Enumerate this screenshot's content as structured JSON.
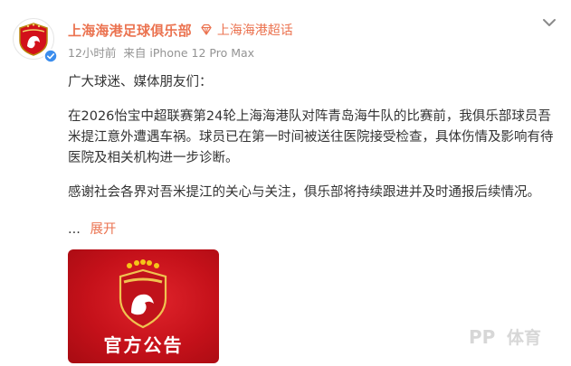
{
  "post": {
    "author": "上海海港足球俱乐部",
    "tag_label": "上海海港超话",
    "time": "12小时前",
    "source": "来自 iPhone 12 Pro Max",
    "paragraphs": [
      "广大球迷、媒体朋友们：",
      "在2026怡宝中超联赛第24轮上海海港队对阵青岛海牛队的比赛前，我俱乐部球员吾米提江意外遭遇车祸。球员已在第一时间被送往医院接受检查，具体伤情及影响有待医院及相关机构进一步诊断。",
      "感谢社会各界对吾米提江的关心与关注，俱乐部将持续跟进并及时通报后续情况。"
    ],
    "ellipsis": "...",
    "expand_label": "展开",
    "image_caption": "官方公告"
  },
  "watermark": {
    "logo_text": "PP",
    "text": "体育"
  },
  "icons": {
    "avatar": "club-crest-icon",
    "verified": "verified-badge-icon",
    "tag": "super-topic-diamond-icon",
    "chevron": "chevron-down-icon"
  },
  "colors": {
    "accent": "#eb7350",
    "text": "#333333",
    "meta": "#939393",
    "verified": "#3b8ded",
    "image_bg": "#c5111a"
  }
}
